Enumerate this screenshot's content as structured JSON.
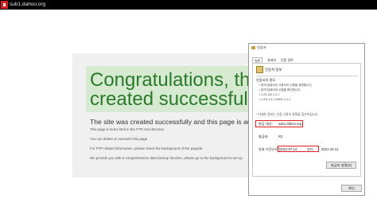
{
  "browser": {
    "url": "sub1.dahoo.org"
  },
  "page": {
    "headline_line1": "Congratulations, the sit",
    "headline_line2": "created successfully!",
    "message": "The site was created successfully and this page is automatical",
    "bullets": [
      "This page is index.html in the FTP root directory",
      "You can delete or overwrite this page",
      "For FTP related information, please check the background of the pagoda",
      "We provide you with a comprehensive data backup function, please go to the background to set up"
    ]
  },
  "dialog": {
    "title": "인증서",
    "tabs": [
      "일반",
      "자세히",
      "인증 경로"
    ],
    "header": "인증서 정보",
    "purpose_label": "인증서의 용도:",
    "purposes": [
      "• 원격 컴퓨터의 사용자의 신원을 증명합니다.",
      "• 원격 컴퓨터의 신원을 확인합니다.",
      "• 2.23.140.1.2.1",
      "• 1.3.6.1.4.1.44947.1.1.1"
    ],
    "note": "* 자세한 정보는 인증 기관의 설명을 참조하십시오.",
    "issued_to_label": "발급 대상:",
    "issued_to_value": "sub1.dahoo.org",
    "issued_by_label": "발급자:",
    "issued_by_value": "R3",
    "valid_label": "유효 기간(시작)",
    "valid_from": "2021-07-14",
    "valid_to_label": "부터",
    "valid_to": "2021-10-12",
    "issuer_stmt_button": "발급자 설명(S)",
    "ok_button": "확인"
  }
}
